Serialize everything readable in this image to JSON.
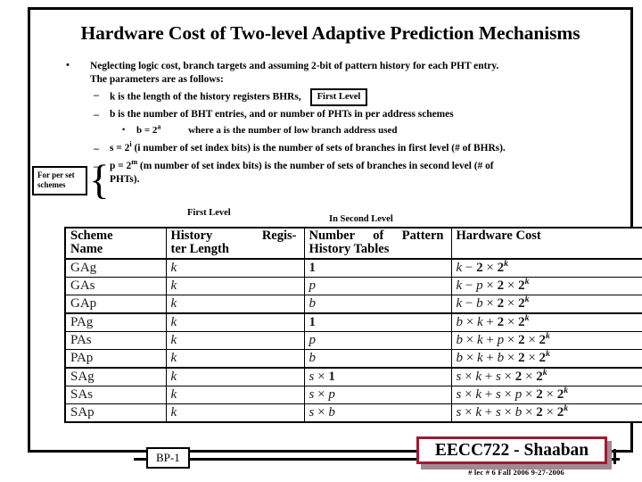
{
  "slide": {
    "title": "Hardware Cost of Two-level Adaptive Prediction Mechanisms"
  },
  "body": {
    "bullet1_line1": "Neglecting logic cost, branch targets and assuming 2-bit of pattern history for each PHT entry.",
    "bullet1_line2": "The parameters are as follows:",
    "sub1": "k is the length of the history registers BHRs,",
    "sub1_callout": "First Level",
    "sub2": "b is the number of BHT entries, and or number of PHTs in per address schemes",
    "sub2_detail_lead": "b = 2",
    "sub2_detail_exp": "a",
    "sub2_detail_rest": "where a is the number of low branch address used",
    "sub3_lead": "s = 2",
    "sub3_exp": "i",
    "sub3_rest": "(i number of set index bits)  is the number of sets of branches in first level (# of BHRs).",
    "sub4_lead": "p = 2",
    "sub4_exp": "m",
    "sub4_rest": "(m number of set index bits) is the number of sets of branches in second level  (# of",
    "sub4_cont": "PHTs).",
    "per_set_callout_line1": "For per set",
    "per_set_callout_line2": "schemes",
    "brace_glyph": "{"
  },
  "labels": {
    "first_level": "First Level",
    "second_level": "In Second Level"
  },
  "table": {
    "headers": [
      "Scheme Name",
      "History Register Length",
      "Number of Pattern History Tables",
      "Hardware Cost"
    ],
    "header_lines": [
      [
        "Scheme",
        "Name"
      ],
      [
        "History   Regis-",
        "ter Length"
      ],
      [
        "Number   of   Pattern",
        "History Tables"
      ],
      [
        "Hardware Cost",
        ""
      ]
    ],
    "rows": [
      {
        "scheme": "GAg",
        "history": "k",
        "phts": "1",
        "cost": "k − 2 × 2^k",
        "group_start": false
      },
      {
        "scheme": "GAs",
        "history": "k",
        "phts": "p",
        "cost": "k − p × 2 × 2^k",
        "group_start": false
      },
      {
        "scheme": "GAp",
        "history": "k",
        "phts": "b",
        "cost": "k − b × 2 × 2^k",
        "group_start": false
      },
      {
        "scheme": "PAg",
        "history": "k",
        "phts": "1",
        "cost": "b × k + 2 × 2^k",
        "group_start": true
      },
      {
        "scheme": "PAs",
        "history": "k",
        "phts": "p",
        "cost": "b × k + p × 2 × 2^k",
        "group_start": false
      },
      {
        "scheme": "PAp",
        "history": "k",
        "phts": "b",
        "cost": "b × k + b × 2 × 2^k",
        "group_start": false
      },
      {
        "scheme": "SAg",
        "history": "k",
        "phts": "s × 1",
        "cost": "s × k + s × 2 × 2^k",
        "group_start": true
      },
      {
        "scheme": "SAs",
        "history": "k",
        "phts": "s × p",
        "cost": "s × k + s × p × 2 × 2^k",
        "group_start": false
      },
      {
        "scheme": "SAp",
        "history": "k",
        "phts": "s × b",
        "cost": "s × k + s × b × 2 × 2^k",
        "group_start": false
      }
    ]
  },
  "footer": {
    "page_badge": "BP-1",
    "course_badge": "EECC722 - Shaaban",
    "course_sub": "#  lec # 6   Fall 2006   9-27-2006",
    "accent_color": "#9e1b32"
  }
}
